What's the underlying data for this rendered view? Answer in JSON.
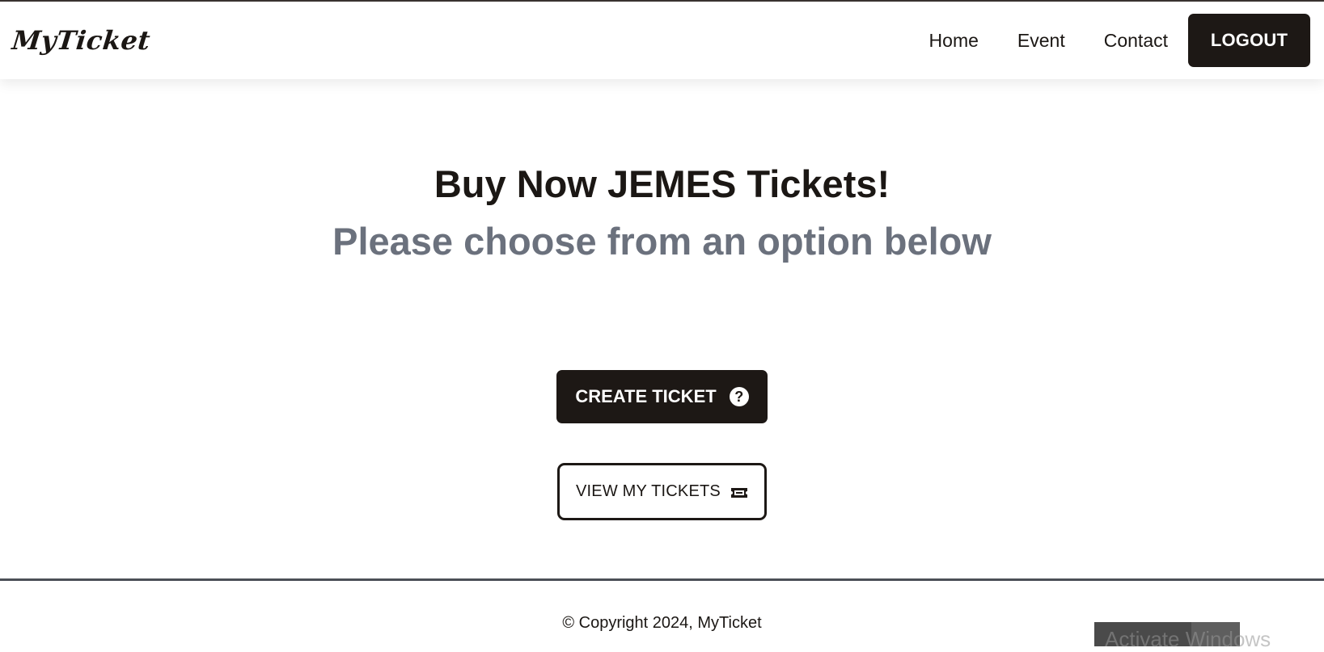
{
  "header": {
    "brand": "MyTicket",
    "nav": {
      "home": "Home",
      "event": "Event",
      "contact": "Contact"
    },
    "logout_label": "LOGOUT"
  },
  "hero": {
    "title": "Buy Now JEMES Tickets!",
    "subtitle": "Please choose from an option below"
  },
  "actions": {
    "create_label": "CREATE TICKET",
    "create_icon": "question-circle-icon",
    "view_label": "VIEW MY TICKETS",
    "view_icon": "ticket-icon"
  },
  "footer": {
    "copyright": "© Copyright 2024, MyTicket"
  },
  "overlay": {
    "windows_watermark": "Activate Windows"
  },
  "colors": {
    "primary_dark": "#1d1815",
    "subtitle_gray": "#6b717d",
    "rule": "#4b4f57"
  }
}
